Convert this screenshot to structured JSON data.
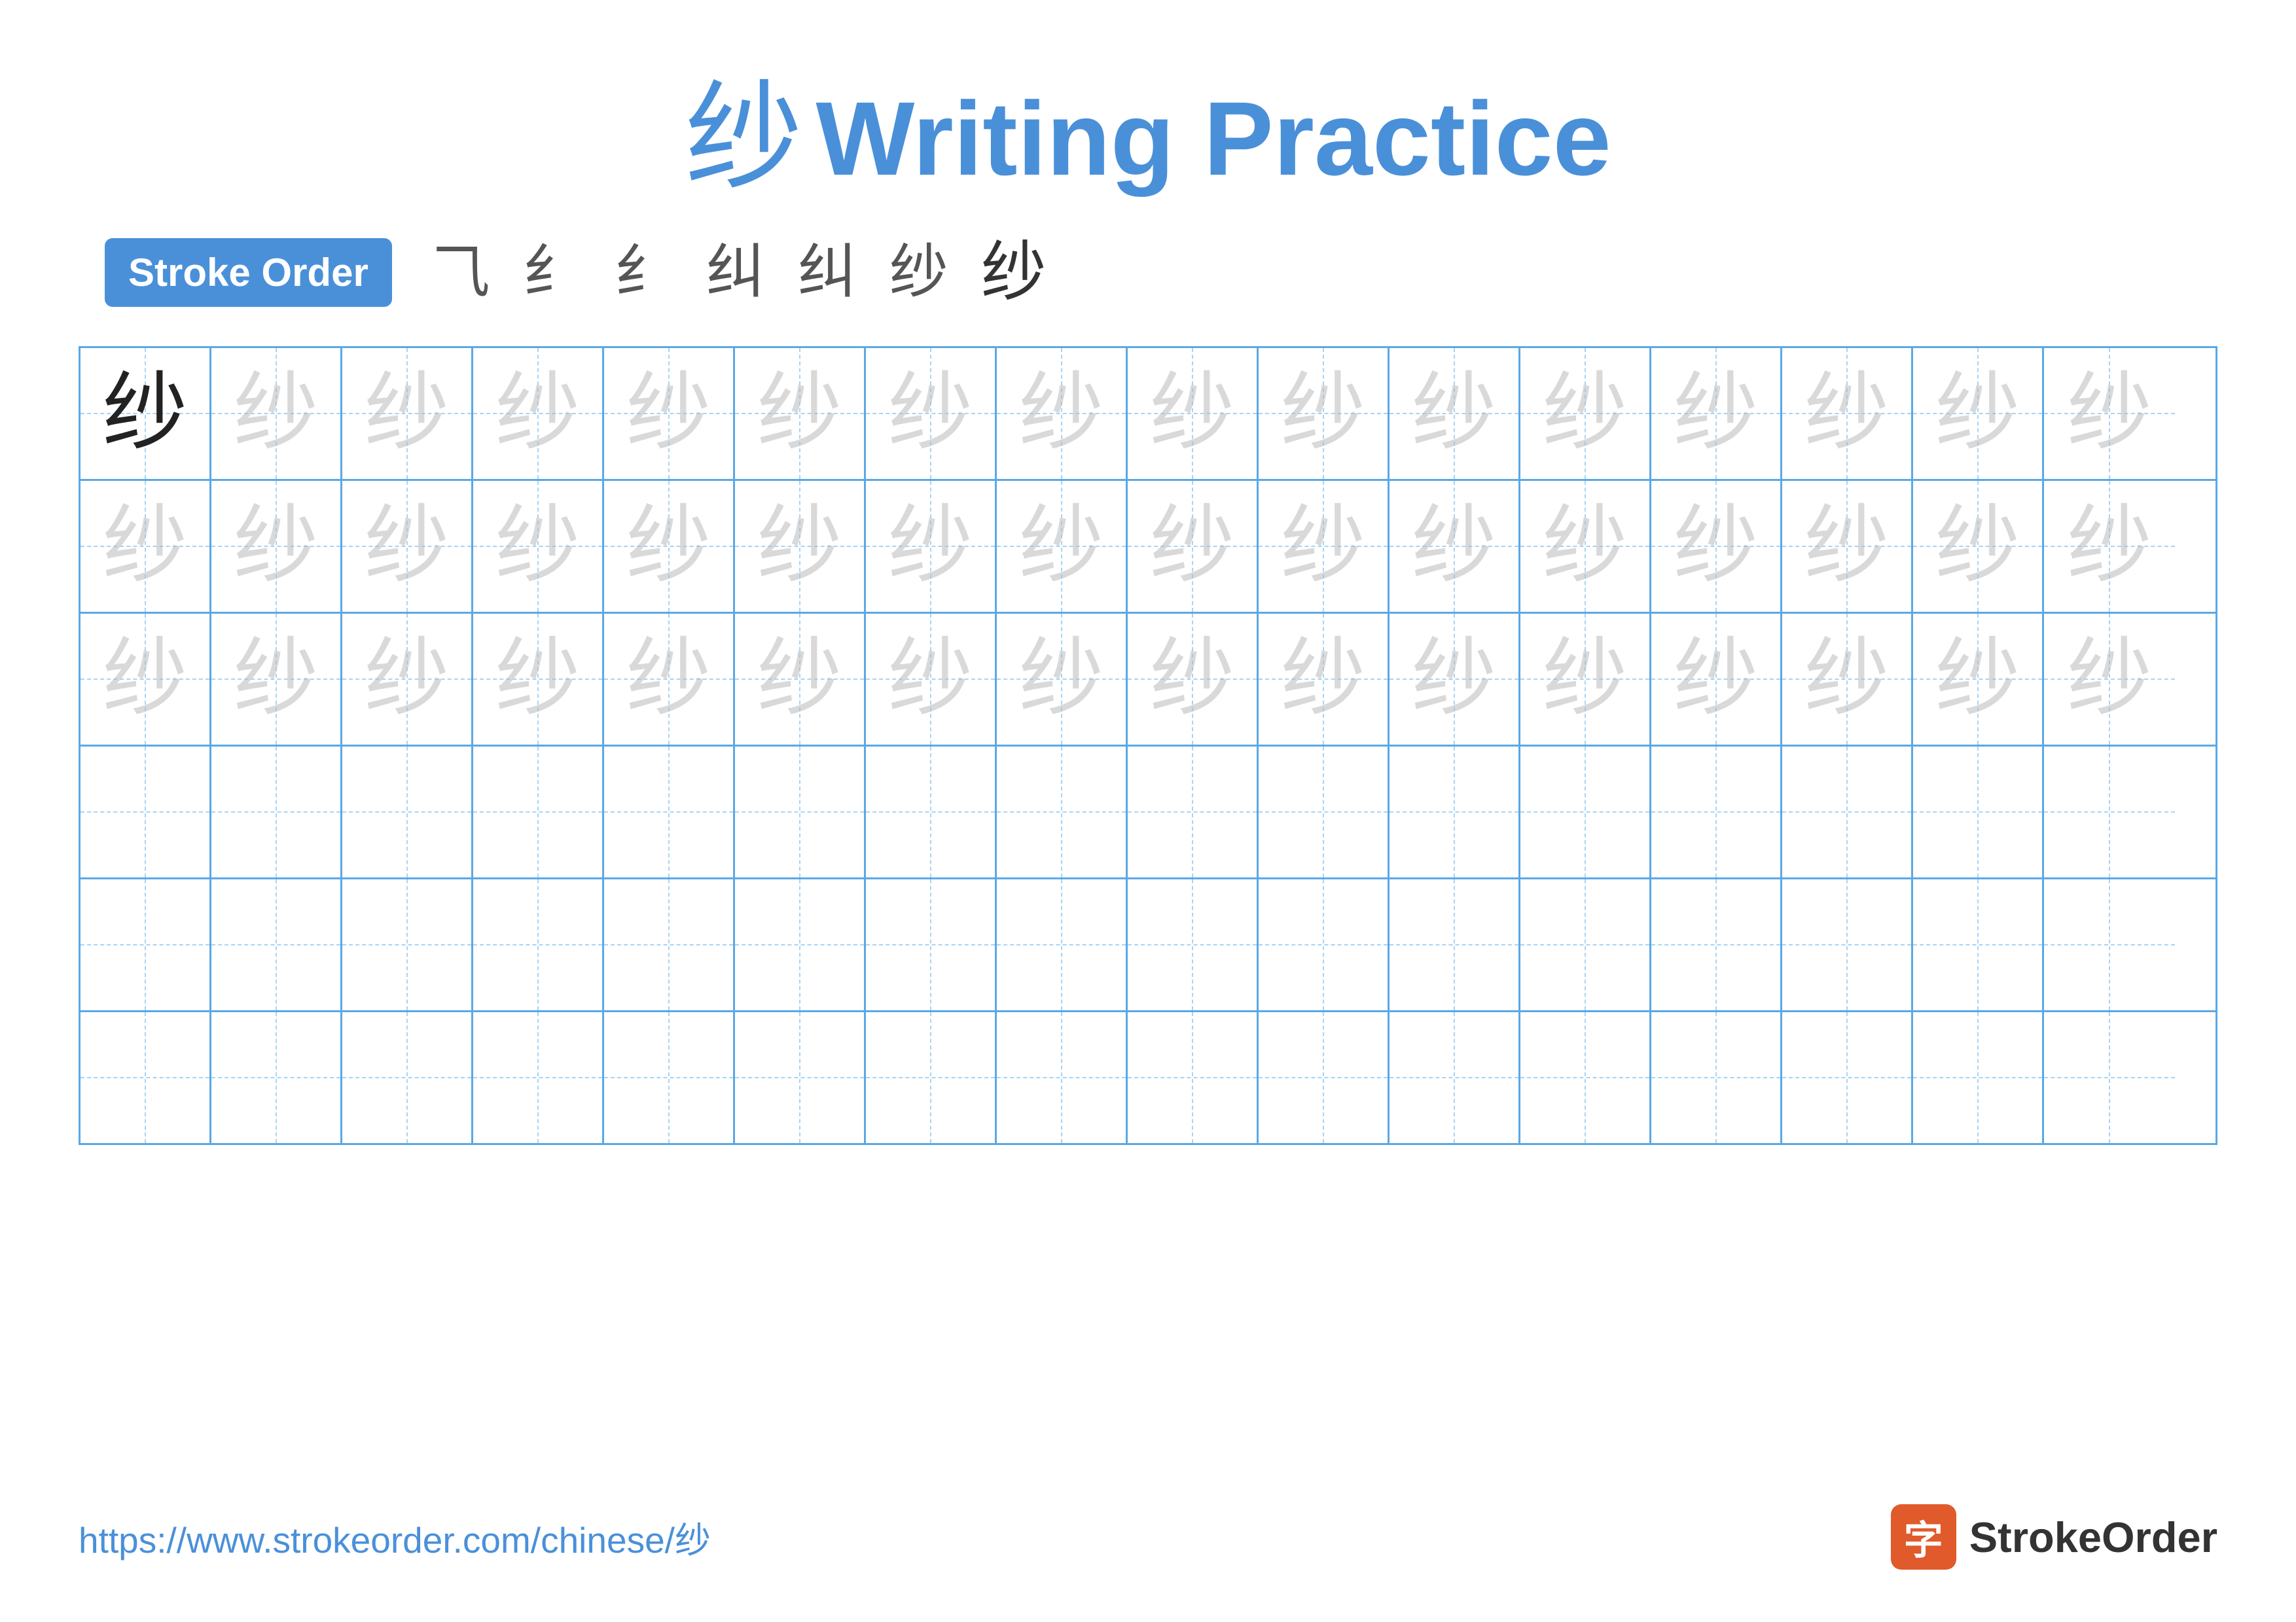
{
  "title": {
    "char": "纱",
    "text": "Writing Practice"
  },
  "stroke_order": {
    "badge_label": "Stroke Order",
    "steps": [
      "⺄",
      "纟",
      "纟",
      "纠",
      "纠",
      "纱",
      "纱"
    ]
  },
  "grid": {
    "rows": 6,
    "cols": 16,
    "char": "纱",
    "filled_rows": 3,
    "empty_rows": 3
  },
  "footer": {
    "url": "https://www.strokeorder.com/chinese/纱",
    "logo_icon": "字",
    "logo_text": "StrokeOrder"
  }
}
